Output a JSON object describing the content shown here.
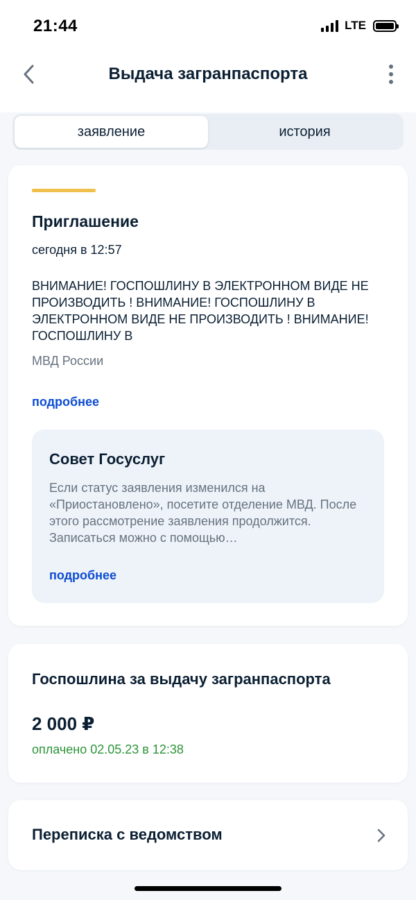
{
  "status_bar": {
    "time": "21:44",
    "network": "LTE"
  },
  "header": {
    "title": "Выдача загранпаспорта",
    "back_icon": "chevron-left-icon",
    "menu_icon": "more-vertical-icon"
  },
  "tabs": [
    {
      "label": "заявление",
      "active": true
    },
    {
      "label": "история",
      "active": false
    }
  ],
  "invitation": {
    "title": "Приглашение",
    "date": "сегодня в 12:57",
    "text": "ВНИМАНИЕ! ГОСПОШЛИНУ В ЭЛЕКТРОННОМ ВИДЕ НЕ ПРОИЗВОДИТЬ ! ВНИМАНИЕ! ГОСПОШЛИНУ В ЭЛЕКТРОННОМ ВИДЕ НЕ ПРОИЗВОДИТЬ ! ВНИМАНИЕ!ГОСПОШЛИНУ В",
    "organization": "МВД России",
    "more_link": "подробнее",
    "accent_color": "#f0c04c"
  },
  "advice": {
    "title": "Совет Госуслуг",
    "text": "Если статус заявления изменился на «Приостановлено», посетите отделение МВД. После этого рассмотрение заявления продолжится. Записаться можно с помощью…",
    "more_link": "подробнее"
  },
  "fee": {
    "title": "Госпошлина за выдачу загранпаспорта",
    "amount": "2 000 ₽",
    "status": "оплачено 02.05.23 в 12:38",
    "status_color": "#2b9438"
  },
  "correspondence": {
    "label": "Переписка с ведомством",
    "icon": "chevron-right-icon"
  },
  "colors": {
    "link": "#0d4cd3",
    "background": "#f5f7fb",
    "secondary_text": "#66727f"
  }
}
